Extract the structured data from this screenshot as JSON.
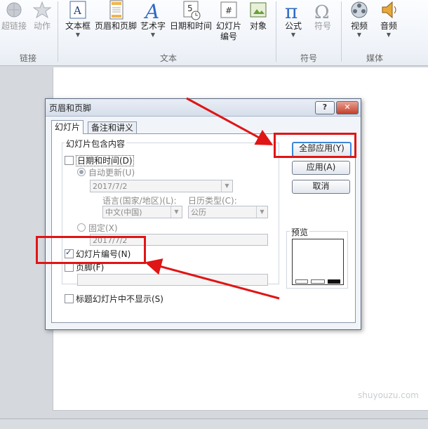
{
  "ribbon": {
    "groups": [
      {
        "label": "链接",
        "items": [
          {
            "label": "超链接",
            "icon": "hyperlink-icon",
            "disabled": true
          },
          {
            "label": "动作",
            "icon": "action-icon",
            "disabled": true
          }
        ]
      },
      {
        "label": "文本",
        "items": [
          {
            "label": "文本框",
            "icon": "textbox-icon"
          },
          {
            "label": "页眉和页脚",
            "icon": "header-footer-icon"
          },
          {
            "label": "艺术字",
            "icon": "wordart-icon"
          },
          {
            "label": "日期和时间",
            "icon": "date-time-icon"
          },
          {
            "label": "幻灯片",
            "label2": "编号",
            "icon": "slide-number-icon"
          },
          {
            "label": "对象",
            "icon": "object-icon"
          }
        ]
      },
      {
        "label": "符号",
        "items": [
          {
            "label": "公式",
            "icon": "equation-icon"
          },
          {
            "label": "符号",
            "icon": "symbol-icon",
            "disabled": true
          }
        ]
      },
      {
        "label": "媒体",
        "items": [
          {
            "label": "视频",
            "icon": "video-icon"
          },
          {
            "label": "音频",
            "icon": "audio-icon"
          }
        ]
      }
    ]
  },
  "dialog": {
    "title": "页眉和页脚",
    "help_label": "?",
    "close_label": "✕",
    "tabs": [
      "幻灯片",
      "备注和讲义"
    ],
    "fieldset_label": "幻灯片包含内容",
    "date_time_label": "日期和时间(D)",
    "auto_update_label": "自动更新(U)",
    "auto_date_value": "2017/7/2",
    "language_label": "语言(国家/地区)(L):",
    "calendar_label": "日历类型(C):",
    "language_value": "中文(中国)",
    "calendar_value": "公历",
    "fixed_label": "固定(X)",
    "fixed_value": "2017/7/2",
    "slide_number_label": "幻灯片编号(N)",
    "slide_number_checked": true,
    "footer_label": "页脚(F)",
    "footer_value": "",
    "title_slide_label": "标题幻灯片中不显示(S)",
    "apply_all_label": "全部应用(Y)",
    "apply_label": "应用(A)",
    "cancel_label": "取消",
    "preview_label": "预览"
  },
  "watermark": "shuyouzu.com",
  "colors": {
    "annotation": "#e01515",
    "accent": "#3b86d8"
  }
}
